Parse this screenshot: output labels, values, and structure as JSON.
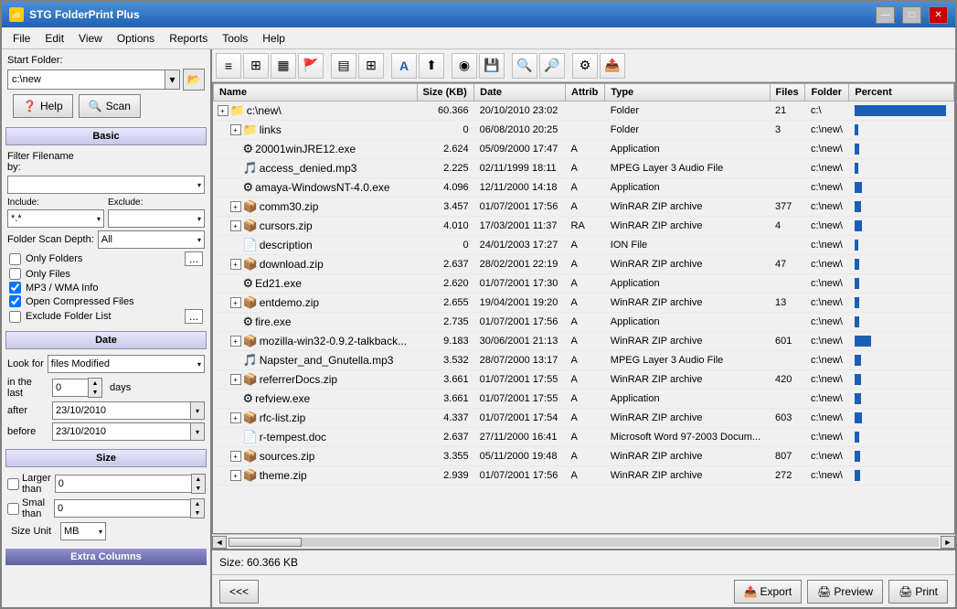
{
  "window": {
    "title": "STG FolderPrint Plus",
    "min_label": "—",
    "max_label": "□",
    "close_label": "✕"
  },
  "menubar": {
    "items": [
      "File",
      "Edit",
      "View",
      "Options",
      "Reports",
      "Tools",
      "Help"
    ]
  },
  "toolbar": {
    "buttons": [
      "≡",
      "⊞",
      "⊟",
      "⚑",
      "▦",
      "▤",
      "A",
      "⬆",
      "◉",
      "📥",
      "🔍",
      "⚙"
    ]
  },
  "left_panel": {
    "start_folder_label": "Start Folder:",
    "folder_value": "c:\\new",
    "help_label": "Help",
    "scan_label": "Scan",
    "basic_label": "Basic",
    "filter_label": "Filter Filename by:",
    "include_label": "Include:",
    "include_value": "*.*",
    "exclude_label": "Exclude:",
    "exclude_value": "",
    "scan_depth_label": "Folder Scan Depth:",
    "scan_depth_value": "All",
    "only_folders_label": "Only Folders",
    "only_files_label": "Only Files",
    "mp3_label": "MP3 / WMA Info",
    "open_compressed_label": "Open Compressed Files",
    "exclude_folder_label": "Exclude Folder List",
    "date_label": "Date",
    "look_for_label": "Look for",
    "look_for_value": "files Modified",
    "in_last_label": "in the last",
    "in_last_value": "0",
    "days_label": "days",
    "after_label": "after",
    "after_value": "23/10/2010",
    "before_label": "before",
    "before_value": "23/10/2010",
    "size_label": "Size",
    "larger_than_label": "Larger than",
    "larger_value": "0",
    "smaller_than_label": "Smal than",
    "smaller_value": "0",
    "size_unit_label": "Size Unit",
    "size_unit_value": "MB",
    "extra_columns_label": "Extra Columns"
  },
  "file_list": {
    "columns": [
      "Name",
      "Size (KB)",
      "Date",
      "Attrib",
      "Type",
      "Files",
      "Folder",
      "Percent"
    ],
    "rows": [
      {
        "indent": 0,
        "expand": true,
        "icon": "folder",
        "name": "c:\\new\\",
        "size": "60.366",
        "date": "20/10/2010 23:02",
        "attrib": "",
        "type": "Folder",
        "files": "21",
        "folder": "c:\\",
        "percent": 100
      },
      {
        "indent": 1,
        "expand": true,
        "icon": "folder",
        "name": "links",
        "size": "0",
        "date": "06/08/2010 20:25",
        "attrib": "",
        "type": "Folder",
        "files": "3",
        "folder": "c:\\new\\",
        "percent": 2
      },
      {
        "indent": 1,
        "expand": false,
        "icon": "app",
        "name": "20001winJRE12.exe",
        "size": "2.624",
        "date": "05/09/2000 17:47",
        "attrib": "A",
        "type": "Application",
        "files": "",
        "folder": "c:\\new\\",
        "percent": 5
      },
      {
        "indent": 1,
        "expand": false,
        "icon": "audio",
        "name": "access_denied.mp3",
        "size": "2.225",
        "date": "02/11/1999 18:11",
        "attrib": "A",
        "type": "MPEG Layer 3 Audio File",
        "files": "",
        "folder": "c:\\new\\",
        "percent": 4
      },
      {
        "indent": 1,
        "expand": false,
        "icon": "app",
        "name": "amaya-WindowsNT-4.0.exe",
        "size": "4.096",
        "date": "12/11/2000 14:18",
        "attrib": "A",
        "type": "Application",
        "files": "",
        "folder": "c:\\new\\",
        "percent": 8
      },
      {
        "indent": 1,
        "expand": true,
        "icon": "zip",
        "name": "comm30.zip",
        "size": "3.457",
        "date": "01/07/2001 17:56",
        "attrib": "A",
        "type": "WinRAR ZIP archive",
        "files": "377",
        "folder": "c:\\new\\",
        "percent": 7
      },
      {
        "indent": 1,
        "expand": true,
        "icon": "zip",
        "name": "cursors.zip",
        "size": "4.010",
        "date": "17/03/2001 11:37",
        "attrib": "RA",
        "type": "WinRAR ZIP archive",
        "files": "4",
        "folder": "c:\\new\\",
        "percent": 8
      },
      {
        "indent": 1,
        "expand": false,
        "icon": "doc",
        "name": "description",
        "size": "0",
        "date": "24/01/2003 17:27",
        "attrib": "A",
        "type": "ION File",
        "files": "",
        "folder": "c:\\new\\",
        "percent": 1
      },
      {
        "indent": 1,
        "expand": true,
        "icon": "zip",
        "name": "download.zip",
        "size": "2.637",
        "date": "28/02/2001 22:19",
        "attrib": "A",
        "type": "WinRAR ZIP archive",
        "files": "47",
        "folder": "c:\\new\\",
        "percent": 5
      },
      {
        "indent": 1,
        "expand": false,
        "icon": "app",
        "name": "Ed21.exe",
        "size": "2.620",
        "date": "01/07/2001 17:30",
        "attrib": "A",
        "type": "Application",
        "files": "",
        "folder": "c:\\new\\",
        "percent": 5
      },
      {
        "indent": 1,
        "expand": true,
        "icon": "zip",
        "name": "entdemo.zip",
        "size": "2.655",
        "date": "19/04/2001 19:20",
        "attrib": "A",
        "type": "WinRAR ZIP archive",
        "files": "13",
        "folder": "c:\\new\\",
        "percent": 5
      },
      {
        "indent": 1,
        "expand": false,
        "icon": "app",
        "name": "fire.exe",
        "size": "2.735",
        "date": "01/07/2001 17:56",
        "attrib": "A",
        "type": "Application",
        "files": "",
        "folder": "c:\\new\\",
        "percent": 5
      },
      {
        "indent": 1,
        "expand": true,
        "icon": "zip",
        "name": "mozilla-win32-0.9.2-talkback...",
        "size": "9.183",
        "date": "30/06/2001 21:13",
        "attrib": "A",
        "type": "WinRAR ZIP archive",
        "files": "601",
        "folder": "c:\\new\\",
        "percent": 18
      },
      {
        "indent": 1,
        "expand": false,
        "icon": "audio",
        "name": "Napster_and_Gnutella.mp3",
        "size": "3.532",
        "date": "28/07/2000 13:17",
        "attrib": "A",
        "type": "MPEG Layer 3 Audio File",
        "files": "",
        "folder": "c:\\new\\",
        "percent": 7
      },
      {
        "indent": 1,
        "expand": true,
        "icon": "zip",
        "name": "referrerDocs.zip",
        "size": "3.661",
        "date": "01/07/2001 17:55",
        "attrib": "A",
        "type": "WinRAR ZIP archive",
        "files": "420",
        "folder": "c:\\new\\",
        "percent": 7
      },
      {
        "indent": 1,
        "expand": false,
        "icon": "app",
        "name": "refview.exe",
        "size": "3.661",
        "date": "01/07/2001 17:55",
        "attrib": "A",
        "type": "Application",
        "files": "",
        "folder": "c:\\new\\",
        "percent": 7
      },
      {
        "indent": 1,
        "expand": true,
        "icon": "zip",
        "name": "rfc-list.zip",
        "size": "4.337",
        "date": "01/07/2001 17:54",
        "attrib": "A",
        "type": "WinRAR ZIP archive",
        "files": "603",
        "folder": "c:\\new\\",
        "percent": 8
      },
      {
        "indent": 1,
        "expand": false,
        "icon": "doc",
        "name": "r-tempest.doc",
        "size": "2.637",
        "date": "27/11/2000 16:41",
        "attrib": "A",
        "type": "Microsoft Word 97-2003 Docum...",
        "files": "",
        "folder": "c:\\new\\",
        "percent": 5
      },
      {
        "indent": 1,
        "expand": true,
        "icon": "zip",
        "name": "sources.zip",
        "size": "3.355",
        "date": "05/11/2000 19:48",
        "attrib": "A",
        "type": "WinRAR ZIP archive",
        "files": "807",
        "folder": "c:\\new\\",
        "percent": 6
      },
      {
        "indent": 1,
        "expand": true,
        "icon": "zip",
        "name": "theme.zip",
        "size": "2.939",
        "date": "01/07/2001 17:56",
        "attrib": "A",
        "type": "WinRAR ZIP archive",
        "files": "272",
        "folder": "c:\\new\\",
        "percent": 6
      }
    ]
  },
  "status": {
    "text": "Size: 60.366  KB"
  },
  "bottom": {
    "nav_label": "<<<",
    "export_label": "Export",
    "preview_label": "Preview",
    "print_label": "Print"
  }
}
